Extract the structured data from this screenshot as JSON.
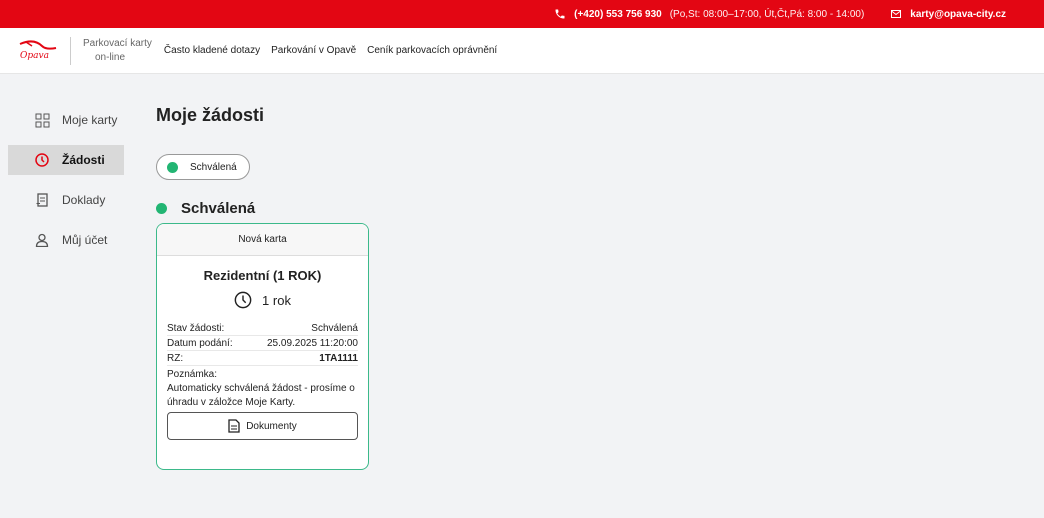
{
  "topbar": {
    "phone": "(+420) 553 756 930",
    "hours": "(Po,St: 08:00–17:00, Út,Čt,Pá: 8:00 - 14:00)",
    "email": "karty@opava-city.cz",
    "phone_icon": "phone-icon",
    "email_icon": "mail-icon"
  },
  "navbar": {
    "logo_text": "Opava",
    "brand_line1": "Parkovací karty",
    "brand_line2": "on-line",
    "links": [
      "Často kladené dotazy",
      "Parkování v Opavě",
      "Ceník parkovacích oprávnění"
    ]
  },
  "sidebar": {
    "items": [
      {
        "label": "Moje karty",
        "icon": "grid-icon"
      },
      {
        "label": "Žádosti",
        "icon": "clock-icon"
      },
      {
        "label": "Doklady",
        "icon": "receipt-icon"
      },
      {
        "label": "Můj účet",
        "icon": "user-icon"
      }
    ]
  },
  "main": {
    "title": "Moje žádosti",
    "filter_label": "Schválená",
    "group_title": "Schválená",
    "card": {
      "header": "Nová karta",
      "title": "Rezidentní (1 ROK)",
      "duration": "1 rok",
      "status_label": "Stav žádosti:",
      "status_value": "Schválená",
      "date_label": "Datum podání:",
      "date_value": "25.09.2025 11:20:00",
      "rz_label": "RZ:",
      "rz_value": "1TA1111",
      "note_label": "Poznámka:",
      "note_text": "Automaticky schválená žádost - prosíme o úhradu v záložce Moje Karty.",
      "documents_button": "Dokumenty"
    }
  },
  "colors": {
    "brand_red": "#e30613",
    "status_green": "#22b573",
    "card_border": "#3bb98a"
  }
}
